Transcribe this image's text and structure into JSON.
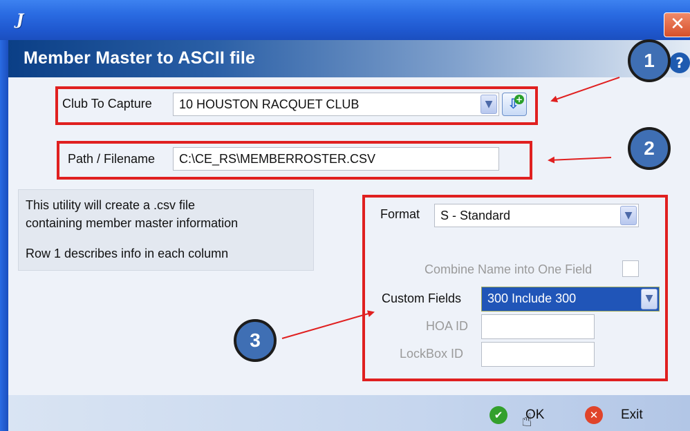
{
  "window": {
    "app_icon_glyph": "J",
    "close_glyph": "✕",
    "header_title": "Member Master to ASCII file",
    "help_glyph": "?"
  },
  "form": {
    "club_label": "Club To Capture",
    "club_value": "10 HOUSTON RACQUET CLUB",
    "path_label": "Path / Filename",
    "path_value": "C:\\CE_RS\\MEMBERROSTER.CSV",
    "info_lines": [
      "This utility will create a .csv file",
      "containing member master information",
      "Row 1 describes info in each column"
    ],
    "format_label": "Format",
    "format_value": "S - Standard",
    "combine_label": "Combine Name into One Field",
    "custom_fields_label": "Custom Fields",
    "custom_fields_value": "300 Include 300",
    "hoa_label": "HOA ID",
    "hoa_value": "",
    "lockbox_label": "LockBox ID",
    "lockbox_value": ""
  },
  "annotations": {
    "badge_1": "1",
    "badge_2": "2",
    "badge_3": "3",
    "highlight_color": "#e02020",
    "badge_color": "#3f6fb4"
  },
  "buttons": {
    "ok_label": "OK",
    "exit_label": "Exit"
  },
  "icons": {
    "dropdown": "chevron-down-icon",
    "capture": "download-arrow-icon",
    "ok": "check-circle-icon",
    "exit": "cancel-circle-icon",
    "cursor": "hand-pointer-icon"
  }
}
